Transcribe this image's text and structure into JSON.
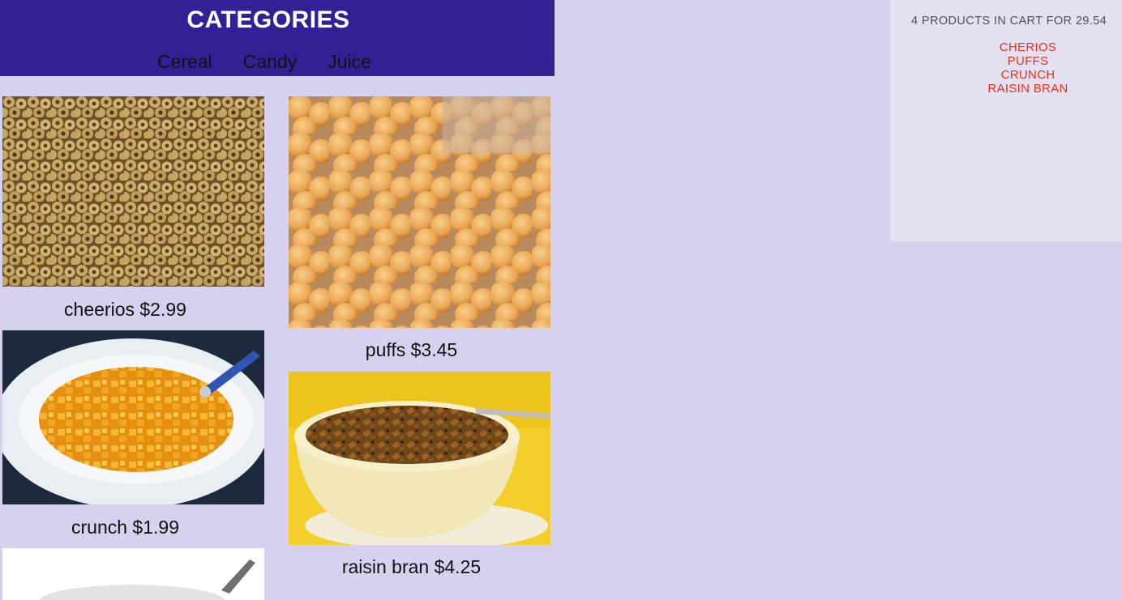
{
  "header": {
    "title": "CATEGORIES",
    "categories": [
      "Cereal",
      "Candy",
      "Juice"
    ]
  },
  "products": [
    {
      "name": "cheerios",
      "price": "$2.99",
      "label": "cheerios $2.99",
      "image": "cheerios-cereal-photo"
    },
    {
      "name": "puffs",
      "price": "$3.45",
      "label": "puffs $3.45",
      "image": "puffs-cereal-photo"
    },
    {
      "name": "crunch",
      "price": "$1.99",
      "label": "crunch $1.99",
      "image": "crunch-cereal-bowl-photo"
    },
    {
      "name": "raisin bran",
      "price": "$4.25",
      "label": "raisin bran $4.25",
      "image": "raisin-bran-bowl-photo"
    },
    {
      "name": "",
      "price": "",
      "label": "",
      "image": "cereal-bowl-photo-partial"
    }
  ],
  "cart": {
    "summary": "4 PRODUCTS IN CART FOR 29.54",
    "items": [
      "CHERIOS",
      "PUFFS",
      "CRUNCH",
      "RAISIN BRAN"
    ]
  },
  "colors": {
    "page_background": "#d5d1ee",
    "header_background": "#332095",
    "cart_background": "#e2e0f1",
    "cart_item": "#e8311c"
  }
}
